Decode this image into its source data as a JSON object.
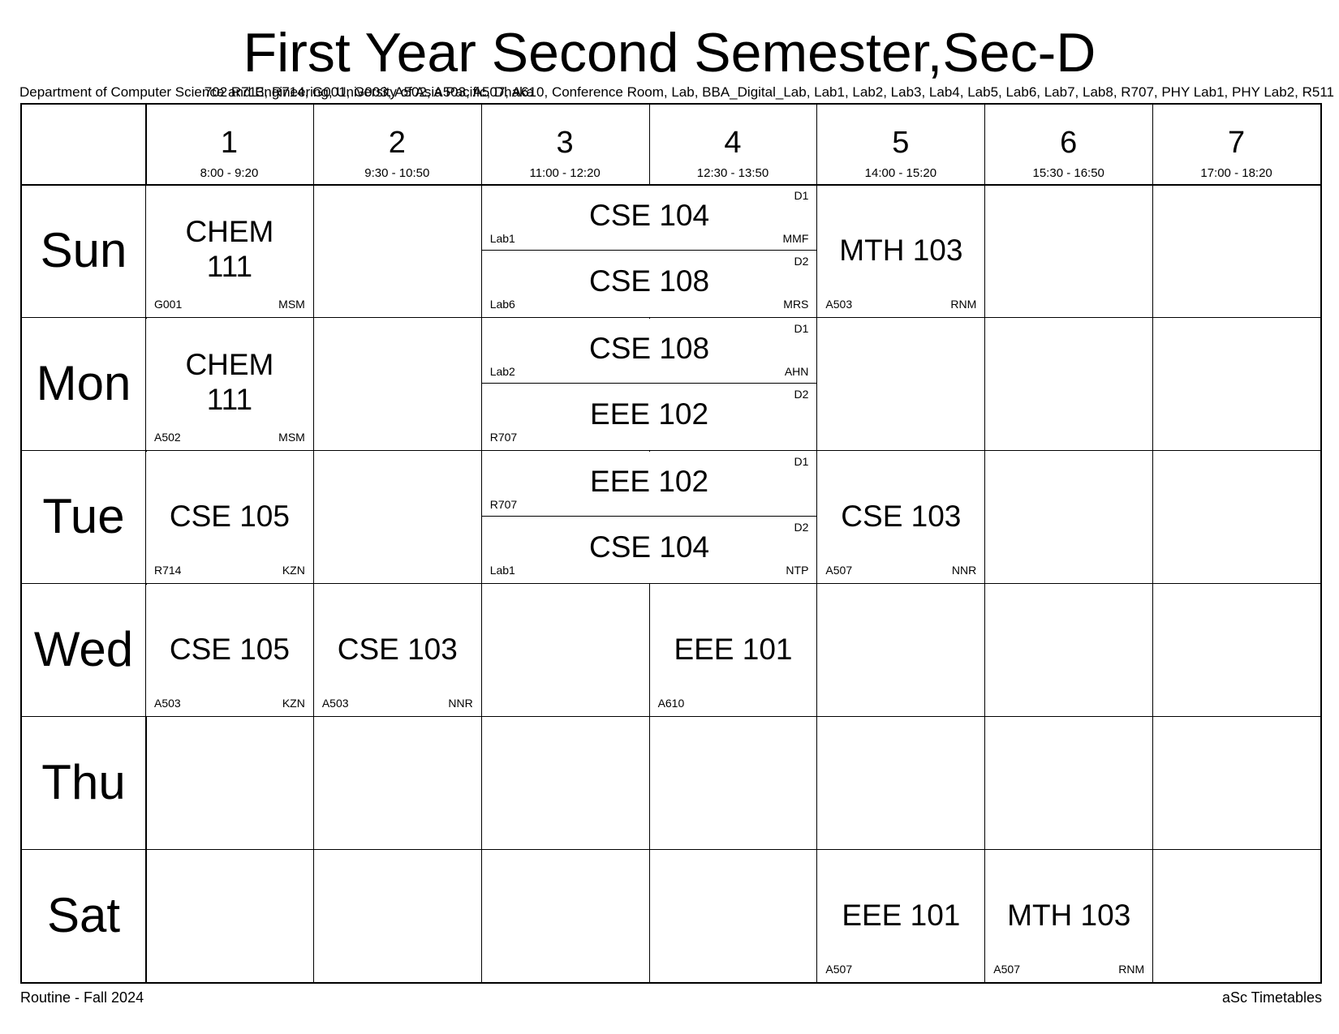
{
  "title": "First Year Second Semester,Sec-D",
  "subtitle": {
    "overlap_a": "702 R713, R714, G001, G003, A502, A503, A507, A610, Conference Room, Lab, BBA_Digital_Lab, Lab1, Lab2, Lab3, Lab4, Lab5, Lab6, Lab7, Lab8, R707, PHY Lab1, PHY Lab2, R511",
    "overlap_b": "Department of Computer Science and Engineering, University of Asia Pacific, Dhaka"
  },
  "periods": [
    {
      "num": "1",
      "time": "8:00 - 9:20"
    },
    {
      "num": "2",
      "time": "9:30 - 10:50"
    },
    {
      "num": "3",
      "time": "11:00 - 12:20"
    },
    {
      "num": "4",
      "time": "12:30 - 13:50"
    },
    {
      "num": "5",
      "time": "14:00 - 15:20"
    },
    {
      "num": "6",
      "time": "15:30 - 16:50"
    },
    {
      "num": "7",
      "time": "17:00 - 18:20"
    }
  ],
  "days": [
    "Sun",
    "Mon",
    "Tue",
    "Wed",
    "Thu",
    "Sat"
  ],
  "entries": [
    {
      "day": 0,
      "start": 0,
      "span": 1,
      "half": "full",
      "subject": "CHEM\n111",
      "room": "G001",
      "teacher": "MSM",
      "group": ""
    },
    {
      "day": 0,
      "start": 2,
      "span": 2,
      "half": "top",
      "subject": "CSE 104",
      "room": "Lab1",
      "teacher": "MMF",
      "group": "D1"
    },
    {
      "day": 0,
      "start": 2,
      "span": 2,
      "half": "bottom",
      "subject": "CSE 108",
      "room": "Lab6",
      "teacher": "MRS",
      "group": "D2"
    },
    {
      "day": 0,
      "start": 4,
      "span": 1,
      "half": "full",
      "subject": "MTH 103",
      "room": "A503",
      "teacher": "RNM",
      "group": ""
    },
    {
      "day": 1,
      "start": 0,
      "span": 1,
      "half": "full",
      "subject": "CHEM\n111",
      "room": "A502",
      "teacher": "MSM",
      "group": ""
    },
    {
      "day": 1,
      "start": 2,
      "span": 2,
      "half": "top",
      "subject": "CSE 108",
      "room": "Lab2",
      "teacher": "AHN",
      "group": "D1"
    },
    {
      "day": 1,
      "start": 2,
      "span": 2,
      "half": "bottom",
      "subject": "EEE 102",
      "room": "R707",
      "teacher": "",
      "group": "D2"
    },
    {
      "day": 2,
      "start": 0,
      "span": 1,
      "half": "full",
      "subject": "CSE 105",
      "room": "R714",
      "teacher": "KZN",
      "group": ""
    },
    {
      "day": 2,
      "start": 2,
      "span": 2,
      "half": "top",
      "subject": "EEE 102",
      "room": "R707",
      "teacher": "",
      "group": "D1"
    },
    {
      "day": 2,
      "start": 2,
      "span": 2,
      "half": "bottom",
      "subject": "CSE 104",
      "room": "Lab1",
      "teacher": "NTP",
      "group": "D2"
    },
    {
      "day": 2,
      "start": 4,
      "span": 1,
      "half": "full",
      "subject": "CSE 103",
      "room": "A507",
      "teacher": "NNR",
      "group": ""
    },
    {
      "day": 3,
      "start": 0,
      "span": 1,
      "half": "full",
      "subject": "CSE 105",
      "room": "A503",
      "teacher": "KZN",
      "group": ""
    },
    {
      "day": 3,
      "start": 1,
      "span": 1,
      "half": "full",
      "subject": "CSE 103",
      "room": "A503",
      "teacher": "NNR",
      "group": ""
    },
    {
      "day": 3,
      "start": 3,
      "span": 1,
      "half": "full",
      "subject": "EEE 101",
      "room": "A610",
      "teacher": "",
      "group": ""
    },
    {
      "day": 5,
      "start": 4,
      "span": 1,
      "half": "full",
      "subject": "EEE 101",
      "room": "A507",
      "teacher": "",
      "group": ""
    },
    {
      "day": 5,
      "start": 5,
      "span": 1,
      "half": "full",
      "subject": "MTH 103",
      "room": "A507",
      "teacher": "RNM",
      "group": ""
    }
  ],
  "footer": {
    "left": "Routine - Fall 2024",
    "right": "aSc Timetables"
  }
}
